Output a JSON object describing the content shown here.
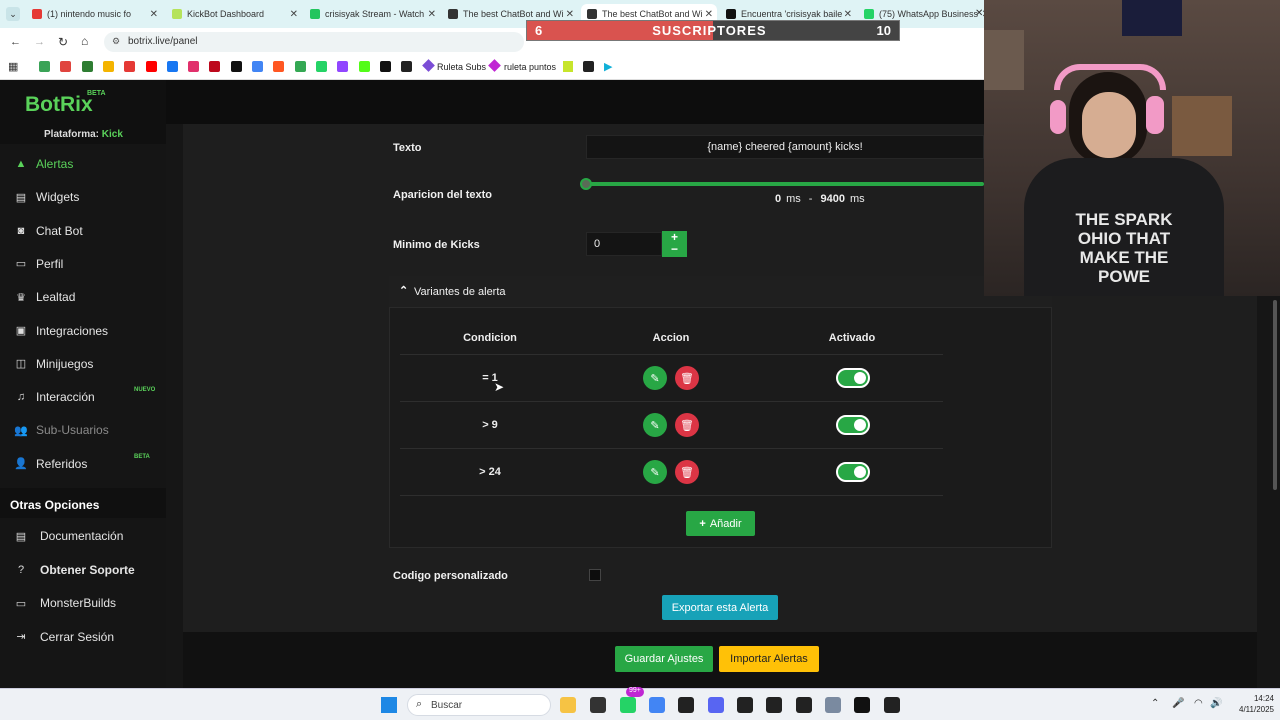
{
  "browser": {
    "tabs": [
      {
        "title": "(1) nintendo music fo",
        "color": "#e53935"
      },
      {
        "title": "KickBot Dashboard",
        "color": "#b5e35a"
      },
      {
        "title": "crisisyak Stream - Watch",
        "color": "#22c55e"
      },
      {
        "title": "The best ChatBot and Wi",
        "color": "#333333"
      },
      {
        "title": "The best ChatBot and Wi",
        "color": "#333333"
      },
      {
        "title": "Encuentra 'crisisyak baile",
        "color": "#111111"
      },
      {
        "title": "(75) WhatsApp Business",
        "color": "#25d366"
      }
    ],
    "url": "botrix.live/panel",
    "bookmarks": [
      "Ruleta Subs",
      "ruleta puntos"
    ]
  },
  "overlay": {
    "start": "6",
    "label": "SUSCRIPTORES",
    "end": "10",
    "progress": 0.5
  },
  "sidebar": {
    "logo": "BotRix",
    "logo_badge": "BETA",
    "platform_label": "Plataforma:",
    "platform_value": "Kick",
    "items": [
      {
        "label": "Alertas",
        "icon": "warning-icon",
        "active": true
      },
      {
        "label": "Widgets",
        "icon": "grid-icon"
      },
      {
        "label": "Chat Bot",
        "icon": "robot-icon"
      },
      {
        "label": "Perfil",
        "icon": "id-card-icon"
      },
      {
        "label": "Lealtad",
        "icon": "trophy-icon"
      },
      {
        "label": "Integraciones",
        "icon": "integrations-icon"
      },
      {
        "label": "Minijuegos",
        "icon": "gamepad-icon"
      },
      {
        "label": "Interacción",
        "icon": "music-icon",
        "badge": "NUEVO"
      },
      {
        "label": "Sub-Usuarios",
        "icon": "users-icon",
        "disabled": true
      },
      {
        "label": "Referidos",
        "icon": "referral-icon",
        "badge": "BETA"
      }
    ],
    "other_title": "Otras Opciones",
    "other_items": [
      {
        "label": "Documentación",
        "icon": "book-icon"
      },
      {
        "label": "Obtener Soporte",
        "icon": "help-icon",
        "bold": true
      },
      {
        "label": "MonsterBuilds",
        "icon": "laptop-icon"
      },
      {
        "label": "Cerrar Sesión",
        "icon": "logout-icon"
      }
    ]
  },
  "form": {
    "texto_label": "Texto",
    "texto_value": "{name} cheered {amount} kicks!",
    "aparicion_label": "Aparicion del texto",
    "range_min": "0",
    "range_max": "9400",
    "range_unit": "ms",
    "range_sep": "-",
    "minimo_label": "Minimo de Kicks",
    "minimo_value": "0",
    "variants_title": "Variantes de alerta",
    "columns": [
      "Condicion",
      "Accion",
      "Activado"
    ],
    "variants": [
      {
        "condition": "= 1",
        "enabled": true
      },
      {
        "condition": "> 9",
        "enabled": true
      },
      {
        "condition": "> 24",
        "enabled": true
      }
    ],
    "add_label": "Añadir",
    "codigo_label": "Codigo personalizado",
    "export_label": "Exportar esta Alerta",
    "save_label": "Guardar Ajustes",
    "import_label": "Importar Alertas"
  },
  "taskbar": {
    "search": "Buscar",
    "time": "14:24",
    "date": "4/11/2025",
    "badge": "99+"
  },
  "webcam": {
    "shirt_text": "THE SPARK OHIO THAT MAKE THE POWE"
  },
  "colors": {
    "green": "#28a745",
    "red": "#dc3545",
    "teal": "#17a2b8",
    "yellow": "#ffc107",
    "brand": "#5ad25a"
  }
}
